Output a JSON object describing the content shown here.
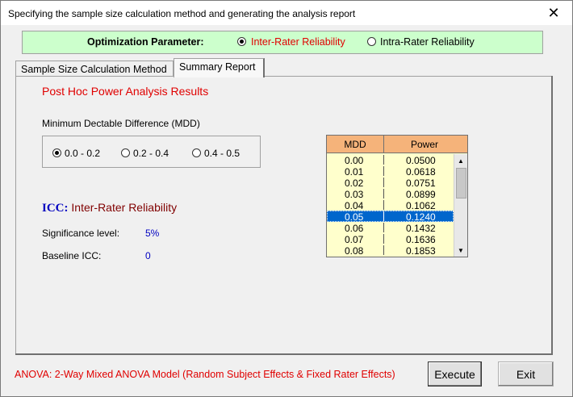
{
  "window": {
    "title": "Specifying the sample size calculation method and generating the analysis report",
    "close_glyph": "✕"
  },
  "optimization": {
    "label": "Optimization Parameter:",
    "options": [
      {
        "label": "Inter-Rater Reliability",
        "selected": true
      },
      {
        "label": "Intra-Rater Reliability",
        "selected": false
      }
    ]
  },
  "tabs": [
    {
      "label": "Sample Size Calculation Method",
      "active": false
    },
    {
      "label": "Summary Report",
      "active": true
    }
  ],
  "report": {
    "heading": "Post Hoc Power Analysis Results",
    "mdd_label": "Minimum Dectable Difference (MDD)",
    "mdd_options": [
      {
        "label": "0.0 - 0.2",
        "selected": true
      },
      {
        "label": "0.2 - 0.4",
        "selected": false
      },
      {
        "label": "0.4 - 0.5",
        "selected": false
      }
    ],
    "icc_key": "ICC:",
    "icc_value": "Inter-Rater Reliability",
    "significance_label": "Significance level:",
    "significance_value": "5%",
    "baseline_label": "Baseline ICC:",
    "baseline_value": "0"
  },
  "power_table": {
    "headers": [
      "MDD",
      "Power"
    ],
    "rows": [
      [
        "0.00",
        "0.0500"
      ],
      [
        "0.01",
        "0.0618"
      ],
      [
        "0.02",
        "0.0751"
      ],
      [
        "0.03",
        "0.0899"
      ],
      [
        "0.04",
        "0.1062"
      ],
      [
        "0.05",
        "0.1240"
      ],
      [
        "0.06",
        "0.1432"
      ],
      [
        "0.07",
        "0.1636"
      ],
      [
        "0.08",
        "0.1853"
      ]
    ],
    "selected_index": 5
  },
  "footer": {
    "anova_text": "ANOVA: 2-Way Mixed ANOVA Model (Random Subject Effects & Fixed Rater Effects)",
    "execute_label": "Execute",
    "exit_label": "Exit"
  },
  "colors": {
    "accent_red": "#e00000",
    "panel_green": "#ccffcc",
    "table_header": "#f5b37a",
    "table_body": "#ffffcc",
    "selection_blue": "#0066cc"
  }
}
